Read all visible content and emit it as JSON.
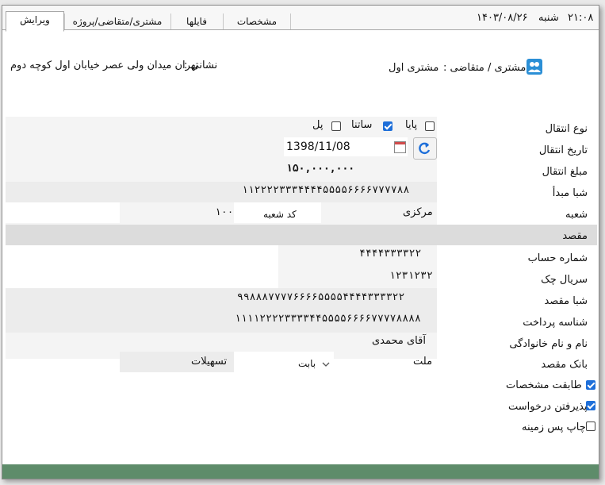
{
  "header": {
    "time": "۲۱:۰۸",
    "day": "شنبه",
    "date": "۱۴۰۳/۰۸/۲۶"
  },
  "tabs": [
    {
      "label": "ویرایش",
      "active": true
    },
    {
      "label": "مشتری/متقاضی/پروژه",
      "active": false
    },
    {
      "label": "فایلها",
      "active": false
    },
    {
      "label": "مشخصات",
      "active": false
    }
  ],
  "customer": {
    "label": "مشتری / متقاضی :",
    "value": "مشتری اول",
    "address_label": "نشانی :",
    "address": "تهران میدان ولی عصر خیابان اول کوچه دوم"
  },
  "form": {
    "transfer_type_label": "نوع انتقال",
    "transfer_types": [
      {
        "label": "پایا",
        "checked": false
      },
      {
        "label": "ساتنا",
        "checked": true
      },
      {
        "label": "پل",
        "checked": false
      }
    ],
    "transfer_date_label": "تاریخ انتقال",
    "transfer_date": "1398/11/08",
    "amount_label": "مبلغ انتقال",
    "amount": "۱۵۰,۰۰۰,۰۰۰",
    "source_sheba_label": "شبا مبدأ",
    "source_sheba": "۱۱۲۲۲۲۳۳۳۴۴۴۴۵۵۵۵۶۶۶۶۷۷۷۷۸۸",
    "branch_label": "شعبه",
    "branch_name": "مرکزی",
    "branch_code_label": "کد شعبه",
    "branch_code": "۱۰۰",
    "destination_label": "مقصد",
    "account_number_label": "شماره حساب",
    "account_number": "۴۴۴۴۳۳۳۳۲۲",
    "cheque_serial_label": "سریال چک",
    "cheque_serial": "۱۲۳۱۲۳۲",
    "dest_sheba_label": "شبا مقصد",
    "dest_sheba": "۹۹۸۸۸۷۷۷۷۶۶۶۶۵۵۵۵۴۴۴۴۳۳۳۳۲۲",
    "payment_id_label": "شناسه پرداخت",
    "payment_id": "۱۱۱۱۲۲۲۲۳۳۳۳۴۴۵۵۵۵۶۶۶۶۷۷۷۷۸۸۸۸",
    "fullname_label": "نام و نام خانوادگی",
    "fullname": "آقای محمدی",
    "dest_bank_label": "بانک مقصد",
    "dest_bank": "ملت",
    "reason_select": "بابت",
    "reason_value": "تسهیلات",
    "match_label": "طابقت مشخصات",
    "match_checked": true,
    "accept_label": "پذیرفتن درخواست",
    "accept_checked": true,
    "bg_print_label": "چاپ پس زمینه",
    "bg_print_checked": false
  },
  "colors": {
    "accent": "#1e6fd9",
    "band": "#f0f0f0",
    "dest_band": "#dcdcdc",
    "footer": "#5e8c6a"
  },
  "icons": {
    "customer": "people-icon",
    "calendar": "calendar-icon",
    "refresh": "refresh-icon"
  }
}
